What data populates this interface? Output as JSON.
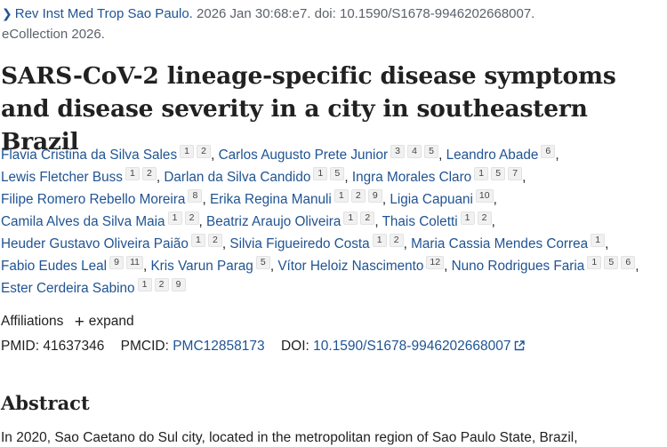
{
  "citation": {
    "journal_link": "Rev Inst Med Trop Sao Paulo.",
    "details_line1": " 2026 Jan 30:68:e7. doi: 10.1590/S1678-9946202668007.",
    "details_line2": "eCollection 2026."
  },
  "article": {
    "title": "SARS-CoV-2 lineage-specific disease symptoms and disease severity in a city in southeastern Brazil"
  },
  "authors": [
    {
      "name": "Flavia Cristina da Silva Sales",
      "affs": [
        "1",
        "2"
      ]
    },
    {
      "name": "Carlos Augusto Prete Junior",
      "affs": [
        "3",
        "4",
        "5"
      ]
    },
    {
      "name": "Leandro Abade",
      "affs": [
        "6"
      ]
    },
    {
      "name": "Lewis Fletcher Buss",
      "affs": [
        "1",
        "2"
      ]
    },
    {
      "name": "Darlan da Silva Candido",
      "affs": [
        "1",
        "5"
      ]
    },
    {
      "name": "Ingra Morales Claro",
      "affs": [
        "1",
        "5",
        "7"
      ]
    },
    {
      "name": "Filipe Romero Rebello Moreira",
      "affs": [
        "8"
      ]
    },
    {
      "name": "Erika Regina Manuli",
      "affs": [
        "1",
        "2",
        "9"
      ]
    },
    {
      "name": "Ligia Capuani",
      "affs": [
        "10"
      ]
    },
    {
      "name": "Camila Alves da Silva Maia",
      "affs": [
        "1",
        "2"
      ]
    },
    {
      "name": "Beatriz Araujo Oliveira",
      "affs": [
        "1",
        "2"
      ]
    },
    {
      "name": "Thais Coletti",
      "affs": [
        "1",
        "2"
      ]
    },
    {
      "name": "Heuder Gustavo Oliveira Paião",
      "affs": [
        "1",
        "2"
      ]
    },
    {
      "name": "Silvia Figueiredo Costa",
      "affs": [
        "1",
        "2"
      ]
    },
    {
      "name": "Maria Cassia Mendes Correa",
      "affs": [
        "1"
      ]
    },
    {
      "name": "Fabio Eudes Leal",
      "affs": [
        "9",
        "11"
      ]
    },
    {
      "name": "Kris Varun Parag",
      "affs": [
        "5"
      ]
    },
    {
      "name": "Vítor Heloiz Nascimento",
      "affs": [
        "12"
      ]
    },
    {
      "name": "Nuno Rodrigues Faria",
      "affs": [
        "1",
        "5",
        "6"
      ]
    },
    {
      "name": "Ester Cerdeira Sabino",
      "affs": [
        "1",
        "2",
        "9"
      ]
    }
  ],
  "affiliations": {
    "label": "Affiliations",
    "expand_label": "expand"
  },
  "identifiers": {
    "pmid_label": "PMID:",
    "pmid": "41637346",
    "pmcid_label": "PMCID:",
    "pmcid": "PMC12858173",
    "doi_label": "DOI:",
    "doi": "10.1590/S1678-9946202668007"
  },
  "abstract": {
    "heading": "Abstract",
    "first_line": "In 2020, Sao Caetano do Sul city, located in the metropolitan region of Sao Paulo State, Brazil,"
  },
  "icons": {
    "citation_chevron": "chevron-right-icon",
    "expand": "plus-icon",
    "doi_external": "external-link-icon"
  },
  "colors": {
    "link": "#205493",
    "text": "#212121",
    "muted": "#5b616b"
  }
}
